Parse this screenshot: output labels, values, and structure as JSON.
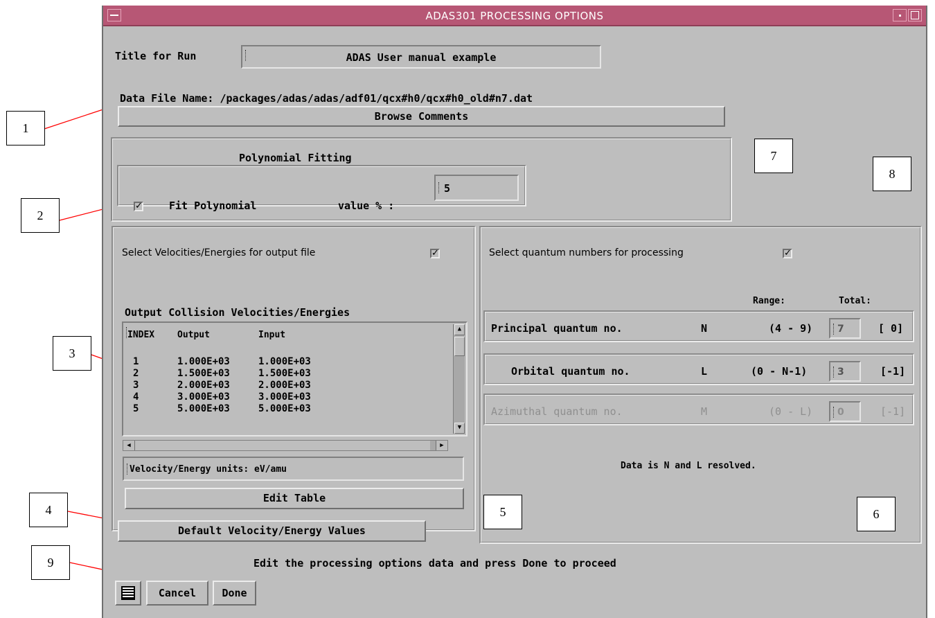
{
  "window": {
    "title": "ADAS301 PROCESSING OPTIONS"
  },
  "run": {
    "label": "Title for Run",
    "value": "ADAS User manual example"
  },
  "datafile": {
    "label": "Data File Name:",
    "path": "/packages/adas/adas/adf01/qcx#h0/qcx#h0_old#n7.dat"
  },
  "browse_label": "Browse Comments",
  "poly": {
    "title": "Polynomial Fitting",
    "checkbox_label": "Fit Polynomial",
    "checked": true,
    "value_label": "value % :",
    "value": "5"
  },
  "velocities": {
    "select_label": "Select Velocities/Energies for output file",
    "checked": true,
    "table_title": "Output Collision Velocities/Energies",
    "columns": [
      "INDEX",
      "Output",
      "Input"
    ],
    "rows": [
      [
        "1",
        "1.000E+03",
        "1.000E+03"
      ],
      [
        "2",
        "1.500E+03",
        "1.500E+03"
      ],
      [
        "3",
        "2.000E+03",
        "2.000E+03"
      ],
      [
        "4",
        "3.000E+03",
        "3.000E+03"
      ],
      [
        "5",
        "5.000E+03",
        "5.000E+03"
      ]
    ],
    "units": "Velocity/Energy units: eV/amu",
    "edit_label": "Edit Table",
    "default_label": "Default Velocity/Energy Values"
  },
  "quantum": {
    "select_label": "Select quantum numbers for processing",
    "checked": true,
    "range_header": "Range:",
    "total_header": "Total:",
    "rows": [
      {
        "name": "Principal quantum no.",
        "sym": "N",
        "range": "(4 - 9)",
        "value": "7",
        "total": "[ 0]",
        "enabled": true
      },
      {
        "name": "Orbital quantum no.",
        "sym": "L",
        "range": "(0 - N-1)",
        "value": "3",
        "total": "[-1]",
        "enabled": true
      },
      {
        "name": "Azimuthal quantum no.",
        "sym": "M",
        "range": "(0 - L)",
        "value": "0",
        "total": "[-1]",
        "enabled": false
      }
    ],
    "resolved_text": "Data is N and L resolved."
  },
  "status_text": "Edit the processing options data and press Done to proceed",
  "buttons": {
    "cancel": "Cancel",
    "done": "Done"
  },
  "callouts": [
    "1",
    "2",
    "3",
    "4",
    "5",
    "6",
    "7",
    "8",
    "9"
  ],
  "colors": {
    "titlebar": "#b75775",
    "panel": "#bebebe",
    "arrow": "#ff0000"
  }
}
